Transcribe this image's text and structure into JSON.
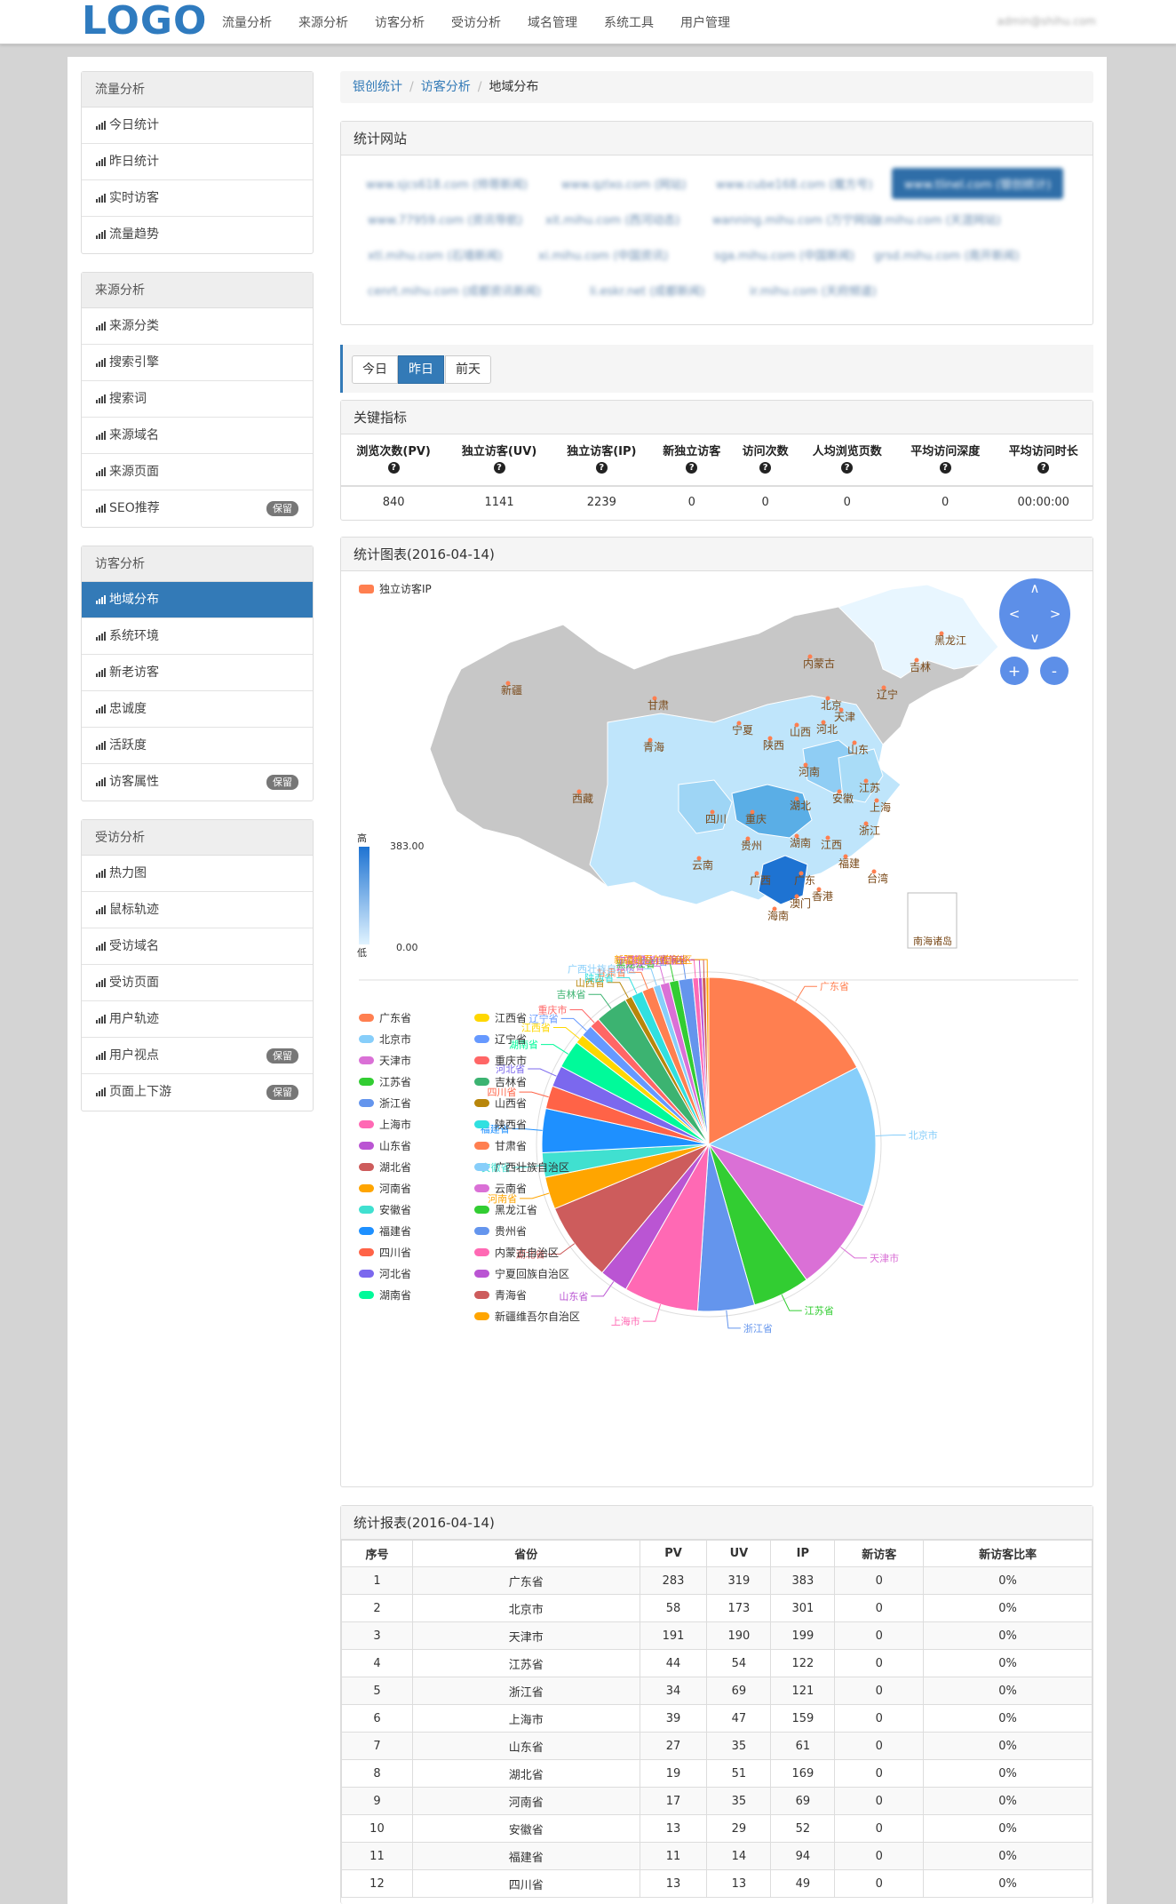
{
  "logo": "LOGO",
  "nav": [
    "流量分析",
    "来源分析",
    "访客分析",
    "受访分析",
    "域名管理",
    "系统工具",
    "用户管理"
  ],
  "user": "admin@shihu.com",
  "sidebar": [
    {
      "title": "流量分析",
      "items": [
        {
          "label": "今日统计"
        },
        {
          "label": "昨日统计"
        },
        {
          "label": "实时访客"
        },
        {
          "label": "流量趋势"
        }
      ]
    },
    {
      "title": "来源分析",
      "items": [
        {
          "label": "来源分类"
        },
        {
          "label": "搜索引擎"
        },
        {
          "label": "搜索词"
        },
        {
          "label": "来源域名"
        },
        {
          "label": "来源页面"
        },
        {
          "label": "SEO推荐",
          "badge": "保留"
        }
      ]
    },
    {
      "title": "访客分析",
      "items": [
        {
          "label": "地域分布",
          "active": true
        },
        {
          "label": "系统环境"
        },
        {
          "label": "新老访客"
        },
        {
          "label": "忠诚度"
        },
        {
          "label": "活跃度"
        },
        {
          "label": "访客属性",
          "badge": "保留"
        }
      ]
    },
    {
      "title": "受访分析",
      "items": [
        {
          "label": "热力图"
        },
        {
          "label": "鼠标轨迹"
        },
        {
          "label": "受访域名"
        },
        {
          "label": "受访页面"
        },
        {
          "label": "用户轨迹"
        },
        {
          "label": "用户视点",
          "badge": "保留"
        },
        {
          "label": "页面上下游",
          "badge": "保留"
        }
      ]
    }
  ],
  "breadcrumb": {
    "root": "银创统计",
    "section": "访客分析",
    "current": "地域分布"
  },
  "sites_panel": {
    "title": "统计网站",
    "rows": [
      [
        "www.sjcs618.com (帅哥新闻)",
        "www.qzlxo.com (网站)",
        "www.cube168.com (魔方号)",
        "www.tlinel.com (银创统计)"
      ],
      [
        "www.77959.com (资讯导航)",
        "xit.mihu.com (西河动态)",
        "wanning.mihu.com (万宁网站)",
        "ir.mihu.com (天涯网站)"
      ],
      [
        "xtl.mihu.com (石墙新闻)",
        "xi.mihu.com (中国资讯)",
        "sga.mihu.com (中国新闻)",
        "grsd.mihu.com (南开新闻)"
      ],
      [
        "cenrt.mihu.com (成都资讯新闻)",
        "li.eskr.net (成都新闻)",
        "ir.mihu.com (天府频道)"
      ]
    ]
  },
  "day_tabs": [
    {
      "label": "今日"
    },
    {
      "label": "昨日",
      "active": true
    },
    {
      "label": "前天"
    }
  ],
  "key_metrics": {
    "title": "关键指标",
    "headers": [
      "浏览次数(PV)",
      "独立访客(UV)",
      "独立访客(IP)",
      "新独立访客",
      "访问次数",
      "人均浏览页数",
      "平均访问深度",
      "平均访问时长"
    ],
    "values": [
      "840",
      "1141",
      "2239",
      "0",
      "0",
      "0",
      "0",
      "00:00:00"
    ]
  },
  "chart_panel": {
    "title": "统计图表(2016-04-14)"
  },
  "map": {
    "legend": "独立访客IP",
    "scale_high": "高",
    "scale_low": "低",
    "scale_max": "383.00",
    "scale_min": "0.00",
    "controls": {
      "up": "∧",
      "down": "∨",
      "left": "<",
      "right": ">",
      "zoom_in": "+",
      "zoom_out": "-"
    },
    "provinces": [
      "黑龙江",
      "吉林",
      "辽宁",
      "内蒙古",
      "北京",
      "天津",
      "河北",
      "山西",
      "山东",
      "新疆",
      "甘肃",
      "宁夏",
      "青海",
      "陕西",
      "河南",
      "江苏",
      "安徽",
      "上海",
      "湖北",
      "四川",
      "重庆",
      "浙江",
      "西藏",
      "贵州",
      "湖南",
      "江西",
      "福建",
      "云南",
      "广西",
      "广东",
      "台湾",
      "香港",
      "澳门",
      "海南",
      "南海诸岛"
    ]
  },
  "chart_data": {
    "type": "pie",
    "series_name": "独立访客IP",
    "legend_col1": [
      "广东省",
      "北京市",
      "天津市",
      "江苏省",
      "浙江省",
      "上海市",
      "山东省",
      "湖北省",
      "河南省",
      "安徽省",
      "福建省",
      "四川省",
      "河北省",
      "湖南省"
    ],
    "legend_col2": [
      "江西省",
      "辽宁省",
      "重庆市",
      "吉林省",
      "山西省",
      "陕西省",
      "甘肃省",
      "广西壮族自治区",
      "云南省",
      "黑龙江省",
      "贵州省",
      "内蒙古自治区",
      "宁夏回族自治区",
      "青海省",
      "新疆维吾尔自治区"
    ],
    "slices": [
      {
        "name": "广东省",
        "value": 383,
        "color": "#ff7f50"
      },
      {
        "name": "北京市",
        "value": 301,
        "color": "#87cefa"
      },
      {
        "name": "天津市",
        "value": 199,
        "color": "#da70d6"
      },
      {
        "name": "江苏省",
        "value": 122,
        "color": "#32cd32"
      },
      {
        "name": "浙江省",
        "value": 121,
        "color": "#6495ed"
      },
      {
        "name": "上海市",
        "value": 159,
        "color": "#ff69b4"
      },
      {
        "name": "山东省",
        "value": 61,
        "color": "#ba55d3"
      },
      {
        "name": "湖北省",
        "value": 169,
        "color": "#cd5c5c"
      },
      {
        "name": "河南省",
        "value": 69,
        "color": "#ffa500"
      },
      {
        "name": "安徽省",
        "value": 52,
        "color": "#40e0d0"
      },
      {
        "name": "福建省",
        "value": 94,
        "color": "#1e90ff"
      },
      {
        "name": "四川省",
        "value": 49,
        "color": "#ff6347"
      },
      {
        "name": "河北省",
        "value": 45,
        "color": "#7b68ee"
      },
      {
        "name": "湖南省",
        "value": 60,
        "color": "#00fa9a"
      },
      {
        "name": "江西省",
        "value": 20,
        "color": "#ffd700"
      },
      {
        "name": "辽宁省",
        "value": 25,
        "color": "#6699ff"
      },
      {
        "name": "重庆市",
        "value": 22,
        "color": "#ff6666"
      },
      {
        "name": "吉林省",
        "value": 70,
        "color": "#3cb371"
      },
      {
        "name": "山西省",
        "value": 15,
        "color": "#b8860b"
      },
      {
        "name": "陕西省",
        "value": 25,
        "color": "#30e0e0"
      },
      {
        "name": "甘肃省",
        "value": 25,
        "color": "#ff7f50"
      },
      {
        "name": "广西壮族自治区",
        "value": 15,
        "color": "#87cefa"
      },
      {
        "name": "云南省",
        "value": 20,
        "color": "#da70d6"
      },
      {
        "name": "黑龙江省",
        "value": 20,
        "color": "#32cd32"
      },
      {
        "name": "贵州省",
        "value": 30,
        "color": "#6495ed"
      },
      {
        "name": "内蒙古自治区",
        "value": 12,
        "color": "#ff69b4"
      },
      {
        "name": "宁夏回族自治区",
        "value": 8,
        "color": "#ba55d3"
      },
      {
        "name": "青海省",
        "value": 8,
        "color": "#cd5c5c"
      },
      {
        "name": "新疆维吾尔自治区",
        "value": 6,
        "color": "#ffa500"
      }
    ]
  },
  "report": {
    "title": "统计报表(2016-04-14)",
    "headers": [
      "序号",
      "省份",
      "PV",
      "UV",
      "IP",
      "新访客",
      "新访客比率"
    ],
    "rows": [
      [
        "1",
        "广东省",
        "283",
        "319",
        "383",
        "0",
        "0%"
      ],
      [
        "2",
        "北京市",
        "58",
        "173",
        "301",
        "0",
        "0%"
      ],
      [
        "3",
        "天津市",
        "191",
        "190",
        "199",
        "0",
        "0%"
      ],
      [
        "4",
        "江苏省",
        "44",
        "54",
        "122",
        "0",
        "0%"
      ],
      [
        "5",
        "浙江省",
        "34",
        "69",
        "121",
        "0",
        "0%"
      ],
      [
        "6",
        "上海市",
        "39",
        "47",
        "159",
        "0",
        "0%"
      ],
      [
        "7",
        "山东省",
        "27",
        "35",
        "61",
        "0",
        "0%"
      ],
      [
        "8",
        "湖北省",
        "19",
        "51",
        "169",
        "0",
        "0%"
      ],
      [
        "9",
        "河南省",
        "17",
        "35",
        "69",
        "0",
        "0%"
      ],
      [
        "10",
        "安徽省",
        "13",
        "29",
        "52",
        "0",
        "0%"
      ],
      [
        "11",
        "福建省",
        "11",
        "14",
        "94",
        "0",
        "0%"
      ],
      [
        "12",
        "四川省",
        "13",
        "13",
        "49",
        "0",
        "0%"
      ]
    ]
  }
}
